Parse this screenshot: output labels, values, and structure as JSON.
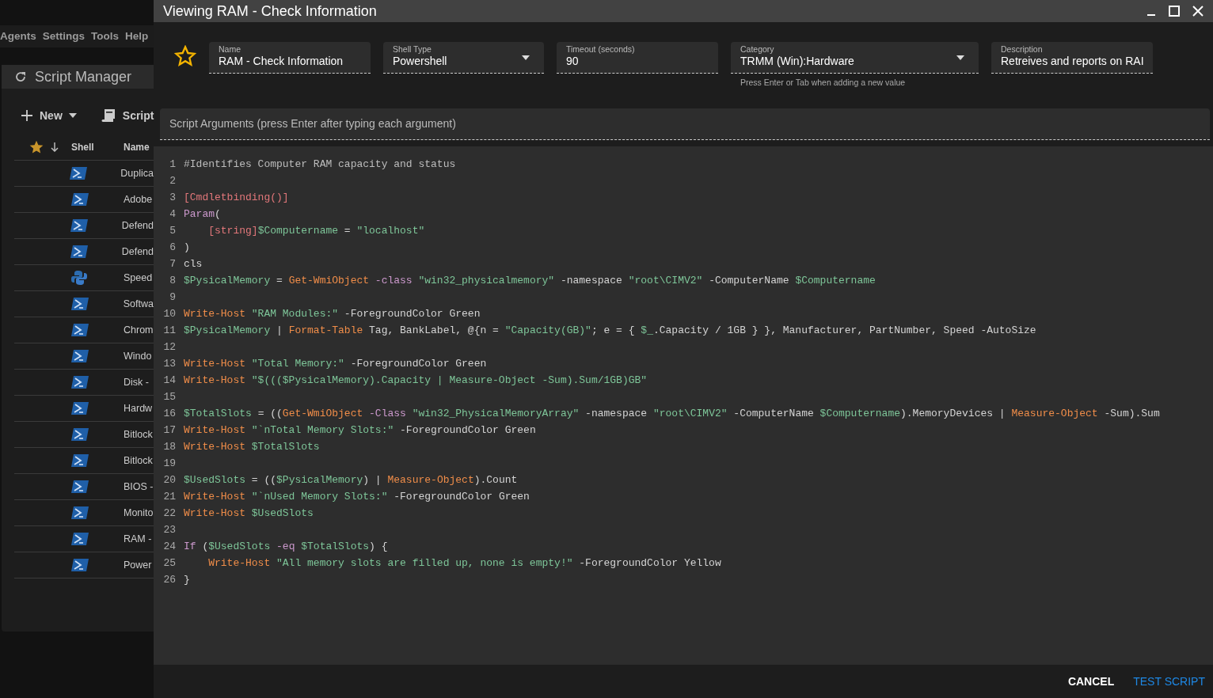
{
  "background_app": {
    "menu": [
      "Agents",
      "Settings",
      "Tools",
      "Help"
    ],
    "script_manager": {
      "title": "Script Manager",
      "toolbar": [
        {
          "kind": "new",
          "label": "New"
        },
        {
          "kind": "script",
          "label": "Script"
        }
      ],
      "columns": [
        "Shell",
        "Name"
      ],
      "rows": [
        {
          "kind": "powershell",
          "name": "Duplica"
        },
        {
          "kind": "powershell",
          "name": "Adobe"
        },
        {
          "kind": "powershell",
          "name": "Defend"
        },
        {
          "kind": "powershell",
          "name": "Defend"
        },
        {
          "kind": "python",
          "name": "Speed"
        },
        {
          "kind": "powershell",
          "name": "Softwa"
        },
        {
          "kind": "powershell",
          "name": "Chrom"
        },
        {
          "kind": "powershell",
          "name": "Windo"
        },
        {
          "kind": "powershell",
          "name": "Disk -"
        },
        {
          "kind": "powershell",
          "name": "Hardw"
        },
        {
          "kind": "powershell",
          "name": "Bitlock"
        },
        {
          "kind": "powershell",
          "name": "Bitlock"
        },
        {
          "kind": "powershell",
          "name": "BIOS -"
        },
        {
          "kind": "powershell",
          "name": "Monito"
        },
        {
          "kind": "powershell",
          "name": "RAM -"
        },
        {
          "kind": "powershell",
          "name": "Power"
        }
      ]
    }
  },
  "dialog": {
    "title": "Viewing RAM - Check Information",
    "favorite": false,
    "fields": [
      {
        "kind": "text",
        "label": "Name",
        "value": "RAM - Check Information"
      },
      {
        "kind": "select",
        "label": "Shell Type",
        "value": "Powershell"
      },
      {
        "kind": "text",
        "label": "Timeout (seconds)",
        "value": "90"
      },
      {
        "kind": "select",
        "label": "Category",
        "value": "TRMM (Win):Hardware",
        "hint": "Press Enter or Tab when adding a new value"
      },
      {
        "kind": "text",
        "label": "Description",
        "value": "Retreives and reports on RAI"
      }
    ],
    "arguments": {
      "placeholder": "Script Arguments (press Enter after typing each argument)"
    },
    "code": [
      {
        "number": "1",
        "tokens": [
          {
            "kind": "comment",
            "text": "#Identifies Computer RAM capacity and status"
          }
        ]
      },
      {
        "number": "2"
      },
      {
        "number": "3",
        "tokens": [
          {
            "kind": "attr",
            "text": "[Cmdletbinding()]"
          }
        ]
      },
      {
        "number": "4",
        "tokens": [
          {
            "kind": "keyword",
            "text": "Param"
          },
          {
            "kind": "text",
            "text": "("
          }
        ]
      },
      {
        "number": "5",
        "indent": true,
        "tokens": [
          {
            "kind": "attr",
            "text": "[string]"
          },
          {
            "kind": "var",
            "text": "$Computername"
          },
          {
            "kind": "text",
            "text": " = "
          },
          {
            "kind": "str",
            "text": "\"localhost\""
          }
        ]
      },
      {
        "number": "6",
        "tokens": [
          {
            "kind": "text",
            "text": ")"
          }
        ]
      },
      {
        "number": "7",
        "tokens": [
          {
            "kind": "text",
            "text": "cls"
          }
        ]
      },
      {
        "number": "8",
        "tokens": [
          {
            "kind": "var",
            "text": "$PysicalMemory"
          },
          {
            "kind": "text",
            "text": " = "
          },
          {
            "kind": "cmd",
            "text": "Get-WmiObject"
          },
          {
            "kind": "op",
            "text": " -class"
          },
          {
            "kind": "str",
            "text": " \"win32_physicalmemory\""
          },
          {
            "kind": "text",
            "text": " -namespace "
          },
          {
            "kind": "str",
            "text": "\"root\\CIMV2\""
          },
          {
            "kind": "text",
            "text": " -ComputerName "
          },
          {
            "kind": "var",
            "text": "$Computername"
          }
        ]
      },
      {
        "number": "9"
      },
      {
        "number": "10",
        "tokens": [
          {
            "kind": "cmd",
            "text": "Write-Host"
          },
          {
            "kind": "str",
            "text": " \"RAM Modules:\""
          },
          {
            "kind": "text",
            "text": " -ForegroundColor Green"
          }
        ]
      },
      {
        "number": "11",
        "tokens": [
          {
            "kind": "var",
            "text": "$PysicalMemory"
          },
          {
            "kind": "text",
            "text": " | "
          },
          {
            "kind": "cmd",
            "text": "Format-Table"
          },
          {
            "kind": "text",
            "text": " Tag, BankLabel, @{n = "
          },
          {
            "kind": "str",
            "text": "\"Capacity(GB)\""
          },
          {
            "kind": "text",
            "text": "; e = { "
          },
          {
            "kind": "var",
            "text": "$_"
          },
          {
            "kind": "text",
            "text": ".Capacity / 1GB } }, Manufacturer, PartNumber, Speed -AutoSize"
          }
        ]
      },
      {
        "number": "12"
      },
      {
        "number": "13",
        "tokens": [
          {
            "kind": "cmd",
            "text": "Write-Host"
          },
          {
            "kind": "str",
            "text": " \"Total Memory:\""
          },
          {
            "kind": "text",
            "text": " -ForegroundColor Green"
          }
        ]
      },
      {
        "number": "14",
        "tokens": [
          {
            "kind": "cmd",
            "text": "Write-Host"
          },
          {
            "kind": "str",
            "text": " \"$((($PysicalMemory).Capacity | Measure-Object -Sum).Sum/1GB)GB\""
          }
        ]
      },
      {
        "number": "15"
      },
      {
        "number": "16",
        "tokens": [
          {
            "kind": "var",
            "text": "$TotalSlots"
          },
          {
            "kind": "text",
            "text": " = (("
          },
          {
            "kind": "cmd",
            "text": "Get-WmiObject"
          },
          {
            "kind": "op",
            "text": " -Class"
          },
          {
            "kind": "str",
            "text": " \"win32_PhysicalMemoryArray\""
          },
          {
            "kind": "text",
            "text": " -namespace "
          },
          {
            "kind": "str",
            "text": "\"root\\CIMV2\""
          },
          {
            "kind": "text",
            "text": " -ComputerName "
          },
          {
            "kind": "var",
            "text": "$Computername"
          },
          {
            "kind": "text",
            "text": ").MemoryDevices | "
          },
          {
            "kind": "cmd",
            "text": "Measure-Object"
          },
          {
            "kind": "text",
            "text": " -Sum).Sum"
          }
        ]
      },
      {
        "number": "17",
        "tokens": [
          {
            "kind": "cmd",
            "text": "Write-Host"
          },
          {
            "kind": "str",
            "text": " \"`nTotal Memory Slots:\""
          },
          {
            "kind": "text",
            "text": " -ForegroundColor Green"
          }
        ]
      },
      {
        "number": "18",
        "tokens": [
          {
            "kind": "cmd",
            "text": "Write-Host"
          },
          {
            "kind": "var",
            "text": " $TotalSlots"
          }
        ]
      },
      {
        "number": "19"
      },
      {
        "number": "20",
        "tokens": [
          {
            "kind": "var",
            "text": "$UsedSlots"
          },
          {
            "kind": "text",
            "text": " = (("
          },
          {
            "kind": "var",
            "text": "$PysicalMemory"
          },
          {
            "kind": "text",
            "text": ") | "
          },
          {
            "kind": "cmd",
            "text": "Measure-Object"
          },
          {
            "kind": "text",
            "text": ").Count"
          }
        ]
      },
      {
        "number": "21",
        "tokens": [
          {
            "kind": "cmd",
            "text": "Write-Host"
          },
          {
            "kind": "str",
            "text": " \"`nUsed Memory Slots:\""
          },
          {
            "kind": "text",
            "text": " -ForegroundColor Green"
          }
        ]
      },
      {
        "number": "22",
        "tokens": [
          {
            "kind": "cmd",
            "text": "Write-Host"
          },
          {
            "kind": "var",
            "text": " $UsedSlots"
          }
        ]
      },
      {
        "number": "23"
      },
      {
        "number": "24",
        "tokens": [
          {
            "kind": "keyword",
            "text": "If"
          },
          {
            "kind": "text",
            "text": " ("
          },
          {
            "kind": "var",
            "text": "$UsedSlots"
          },
          {
            "kind": "op",
            "text": " -eq"
          },
          {
            "kind": "var",
            "text": " $TotalSlots"
          },
          {
            "kind": "text",
            "text": ") {"
          }
        ]
      },
      {
        "number": "25",
        "indent": true,
        "tokens": [
          {
            "kind": "cmd",
            "text": "Write-Host"
          },
          {
            "kind": "str",
            "text": " \"All memory slots are filled up, none is empty!\""
          },
          {
            "kind": "text",
            "text": " -ForegroundColor Yellow"
          }
        ]
      },
      {
        "number": "26",
        "tokens": [
          {
            "kind": "text",
            "text": "}"
          }
        ]
      }
    ],
    "buttons": [
      {
        "kind": "secondary",
        "label": "CANCEL"
      },
      {
        "kind": "primary",
        "label": "TEST SCRIPT"
      }
    ]
  }
}
